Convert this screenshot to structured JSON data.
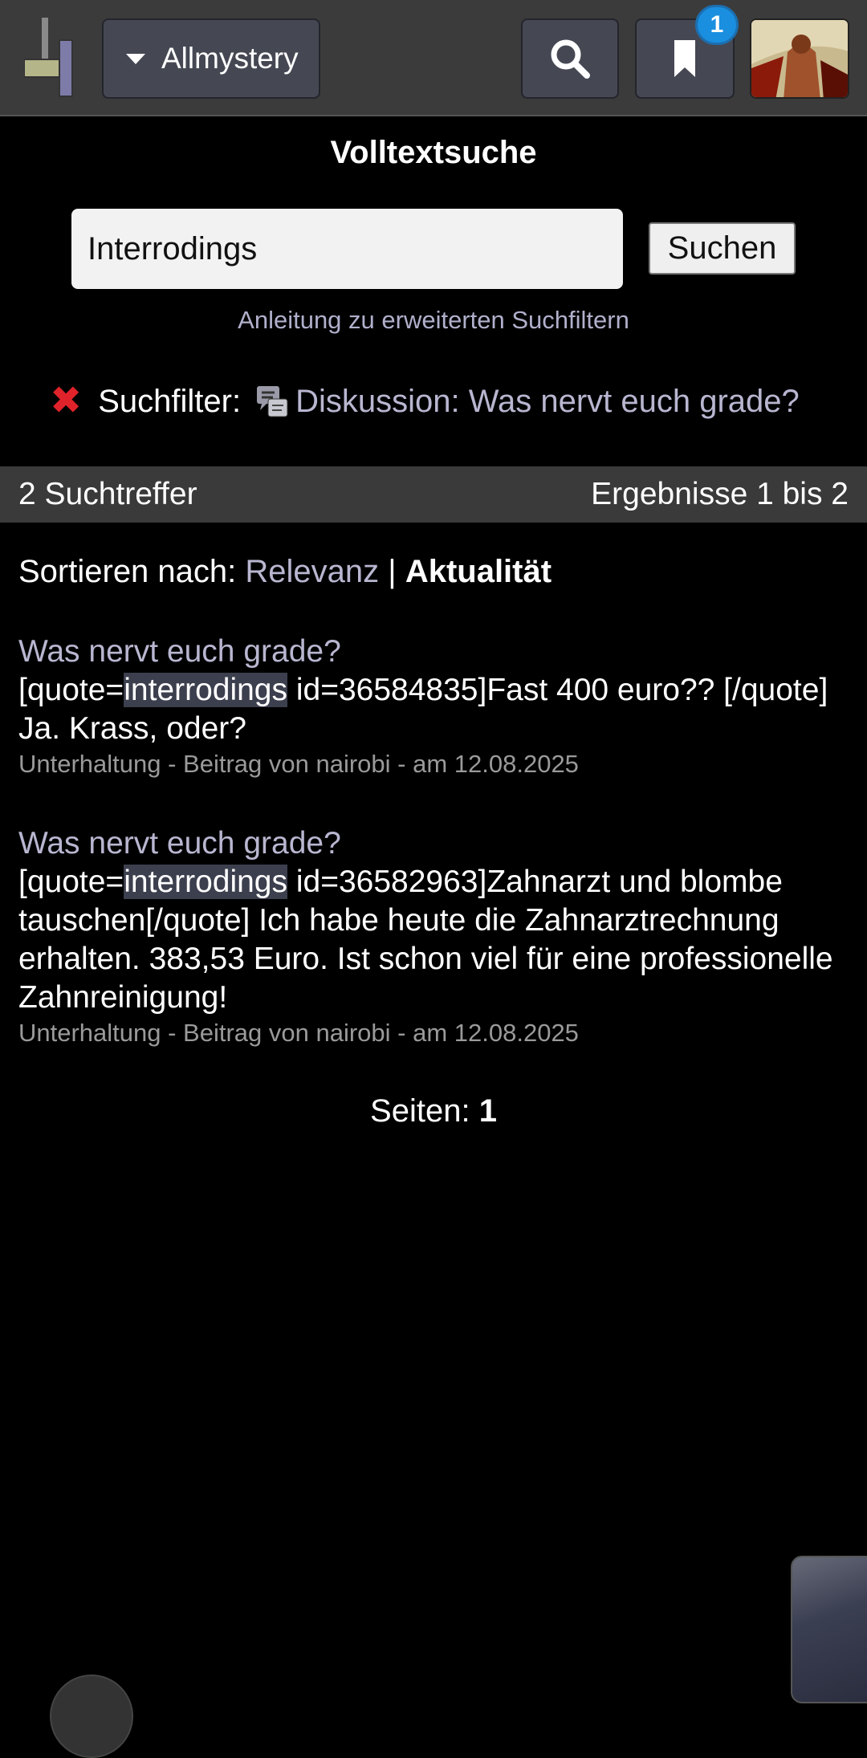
{
  "header": {
    "site_menu_label": "Allmystery",
    "notification_count": "1"
  },
  "search": {
    "heading": "Volltextsuche",
    "query": "Interrodings",
    "submit_label": "Suchen",
    "help_link": "Anleitung zu erweiterten Suchfiltern",
    "filter_label": "Suchfilter:",
    "filter_value": "Diskussion: Was nervt euch grade?"
  },
  "results_bar": {
    "count": "2 Suchtreffer",
    "range": "Ergebnisse 1 bis 2"
  },
  "sort": {
    "label": "Sortieren nach:",
    "relevance": "Relevanz",
    "separator": "|",
    "recency": "Aktualität"
  },
  "results": [
    {
      "title": "Was nervt euch grade?",
      "snippet_before": "[quote=",
      "snippet_highlight": "interrodings",
      "snippet_after": " id=36584835]Fast 400 euro?? [/quote] Ja. Krass, oder?",
      "meta": "Unterhaltung - Beitrag von nairobi - am 12.08.2025"
    },
    {
      "title": "Was nervt euch grade?",
      "snippet_before": "[quote=",
      "snippet_highlight": "interrodings",
      "snippet_after": " id=36582963]Zahnarzt und blombe tauschen[/quote] Ich habe heute die Zahnarztrechnung erhalten. 383,53 Euro. Ist schon viel für eine professionelle Zahnreinigung!",
      "meta": "Unterhaltung - Beitrag von nairobi - am 12.08.2025"
    }
  ],
  "pager": {
    "label": "Seiten:",
    "current": "1"
  },
  "icons": {
    "logo": "allmystery-logo",
    "search": "search-icon",
    "bookmark": "bookmark-icon",
    "remove_filter": "close-icon",
    "discussion": "discussion-icon"
  },
  "colors": {
    "background": "#000000",
    "topbar": "#3b3b3b",
    "link": "#b8b6d0",
    "badge": "#1a8fe0",
    "remove": "#e0232b",
    "highlight": "#3c3f4d"
  }
}
